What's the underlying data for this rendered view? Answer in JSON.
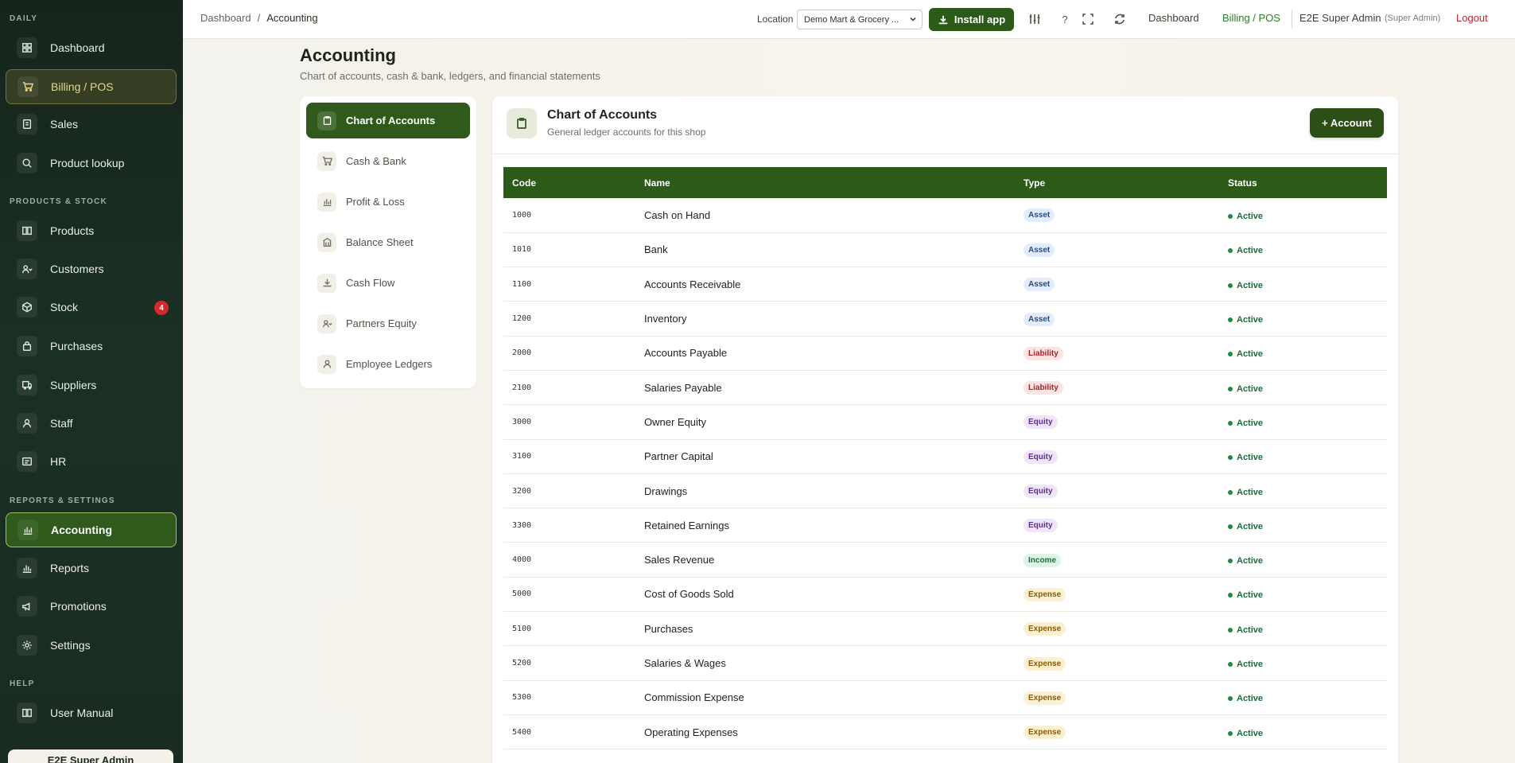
{
  "sidebar": {
    "sections": {
      "daily": "DAILY",
      "products_stock": "PRODUCTS & STOCK",
      "reports_settings": "REPORTS & SETTINGS",
      "help": "HELP"
    },
    "items": [
      {
        "label": "Dashboard",
        "icon": "dashboard-icon"
      },
      {
        "label": "Billing / POS",
        "icon": "cart-icon"
      },
      {
        "label": "Sales",
        "icon": "receipt-icon"
      },
      {
        "label": "Product lookup",
        "icon": "search-icon"
      },
      {
        "label": "Products",
        "icon": "book-icon"
      },
      {
        "label": "Customers",
        "icon": "users-icon"
      },
      {
        "label": "Stock",
        "icon": "box-icon",
        "badge": "4"
      },
      {
        "label": "Purchases",
        "icon": "bag-icon"
      },
      {
        "label": "Suppliers",
        "icon": "truck-icon"
      },
      {
        "label": "Staff",
        "icon": "user-icon"
      },
      {
        "label": "HR",
        "icon": "id-card-icon"
      },
      {
        "label": "Accounting",
        "icon": "chart-icon"
      },
      {
        "label": "Reports",
        "icon": "bar-chart-icon"
      },
      {
        "label": "Promotions",
        "icon": "megaphone-icon"
      },
      {
        "label": "Settings",
        "icon": "gear-icon"
      },
      {
        "label": "User Manual",
        "icon": "manual-icon"
      }
    ],
    "user_card": "E2E Super Admin"
  },
  "topbar": {
    "breadcrumb_root": "Dashboard",
    "breadcrumb_sep": "/",
    "breadcrumb_current": "Accounting",
    "location_label": "Location",
    "location_value": "Demo Mart & Grocery ...",
    "install_label": "Install app",
    "help_glyph": "?",
    "link_dashboard": "Dashboard",
    "link_billing": "Billing / POS",
    "user_name": "E2E Super Admin",
    "user_role": "(Super Admin)",
    "logout": "Logout"
  },
  "page": {
    "title": "Accounting",
    "subtitle": "Chart of accounts, cash & bank, ledgers, and financial statements"
  },
  "subnav": [
    {
      "label": "Chart of Accounts"
    },
    {
      "label": "Cash & Bank"
    },
    {
      "label": "Profit & Loss"
    },
    {
      "label": "Balance Sheet"
    },
    {
      "label": "Cash Flow"
    },
    {
      "label": "Partners Equity"
    },
    {
      "label": "Employee Ledgers"
    }
  ],
  "panel": {
    "title": "Chart of Accounts",
    "subtitle": "General ledger accounts for this shop",
    "add_label": "+ Account",
    "columns": [
      "Code",
      "Name",
      "Type",
      "Status"
    ],
    "rows": [
      {
        "code": "1000",
        "name": "Cash on Hand",
        "type": "Asset",
        "status": "Active"
      },
      {
        "code": "1010",
        "name": "Bank",
        "type": "Asset",
        "status": "Active"
      },
      {
        "code": "1100",
        "name": "Accounts Receivable",
        "type": "Asset",
        "status": "Active"
      },
      {
        "code": "1200",
        "name": "Inventory",
        "type": "Asset",
        "status": "Active"
      },
      {
        "code": "2000",
        "name": "Accounts Payable",
        "type": "Liability",
        "status": "Active"
      },
      {
        "code": "2100",
        "name": "Salaries Payable",
        "type": "Liability",
        "status": "Active"
      },
      {
        "code": "3000",
        "name": "Owner Equity",
        "type": "Equity",
        "status": "Active"
      },
      {
        "code": "3100",
        "name": "Partner Capital",
        "type": "Equity",
        "status": "Active"
      },
      {
        "code": "3200",
        "name": "Drawings",
        "type": "Equity",
        "status": "Active"
      },
      {
        "code": "3300",
        "name": "Retained Earnings",
        "type": "Equity",
        "status": "Active"
      },
      {
        "code": "4000",
        "name": "Sales Revenue",
        "type": "Income",
        "status": "Active"
      },
      {
        "code": "5000",
        "name": "Cost of Goods Sold",
        "type": "Expense",
        "status": "Active"
      },
      {
        "code": "5100",
        "name": "Purchases",
        "type": "Expense",
        "status": "Active"
      },
      {
        "code": "5200",
        "name": "Salaries & Wages",
        "type": "Expense",
        "status": "Active"
      },
      {
        "code": "5300",
        "name": "Commission Expense",
        "type": "Expense",
        "status": "Active"
      },
      {
        "code": "5400",
        "name": "Operating Expenses",
        "type": "Expense",
        "status": "Active"
      }
    ]
  },
  "colors": {
    "brand_green": "#2c5a19",
    "sidebar_bg": "#16251b",
    "logout_red": "#c0262c",
    "billing_link": "#2f7a2a"
  }
}
